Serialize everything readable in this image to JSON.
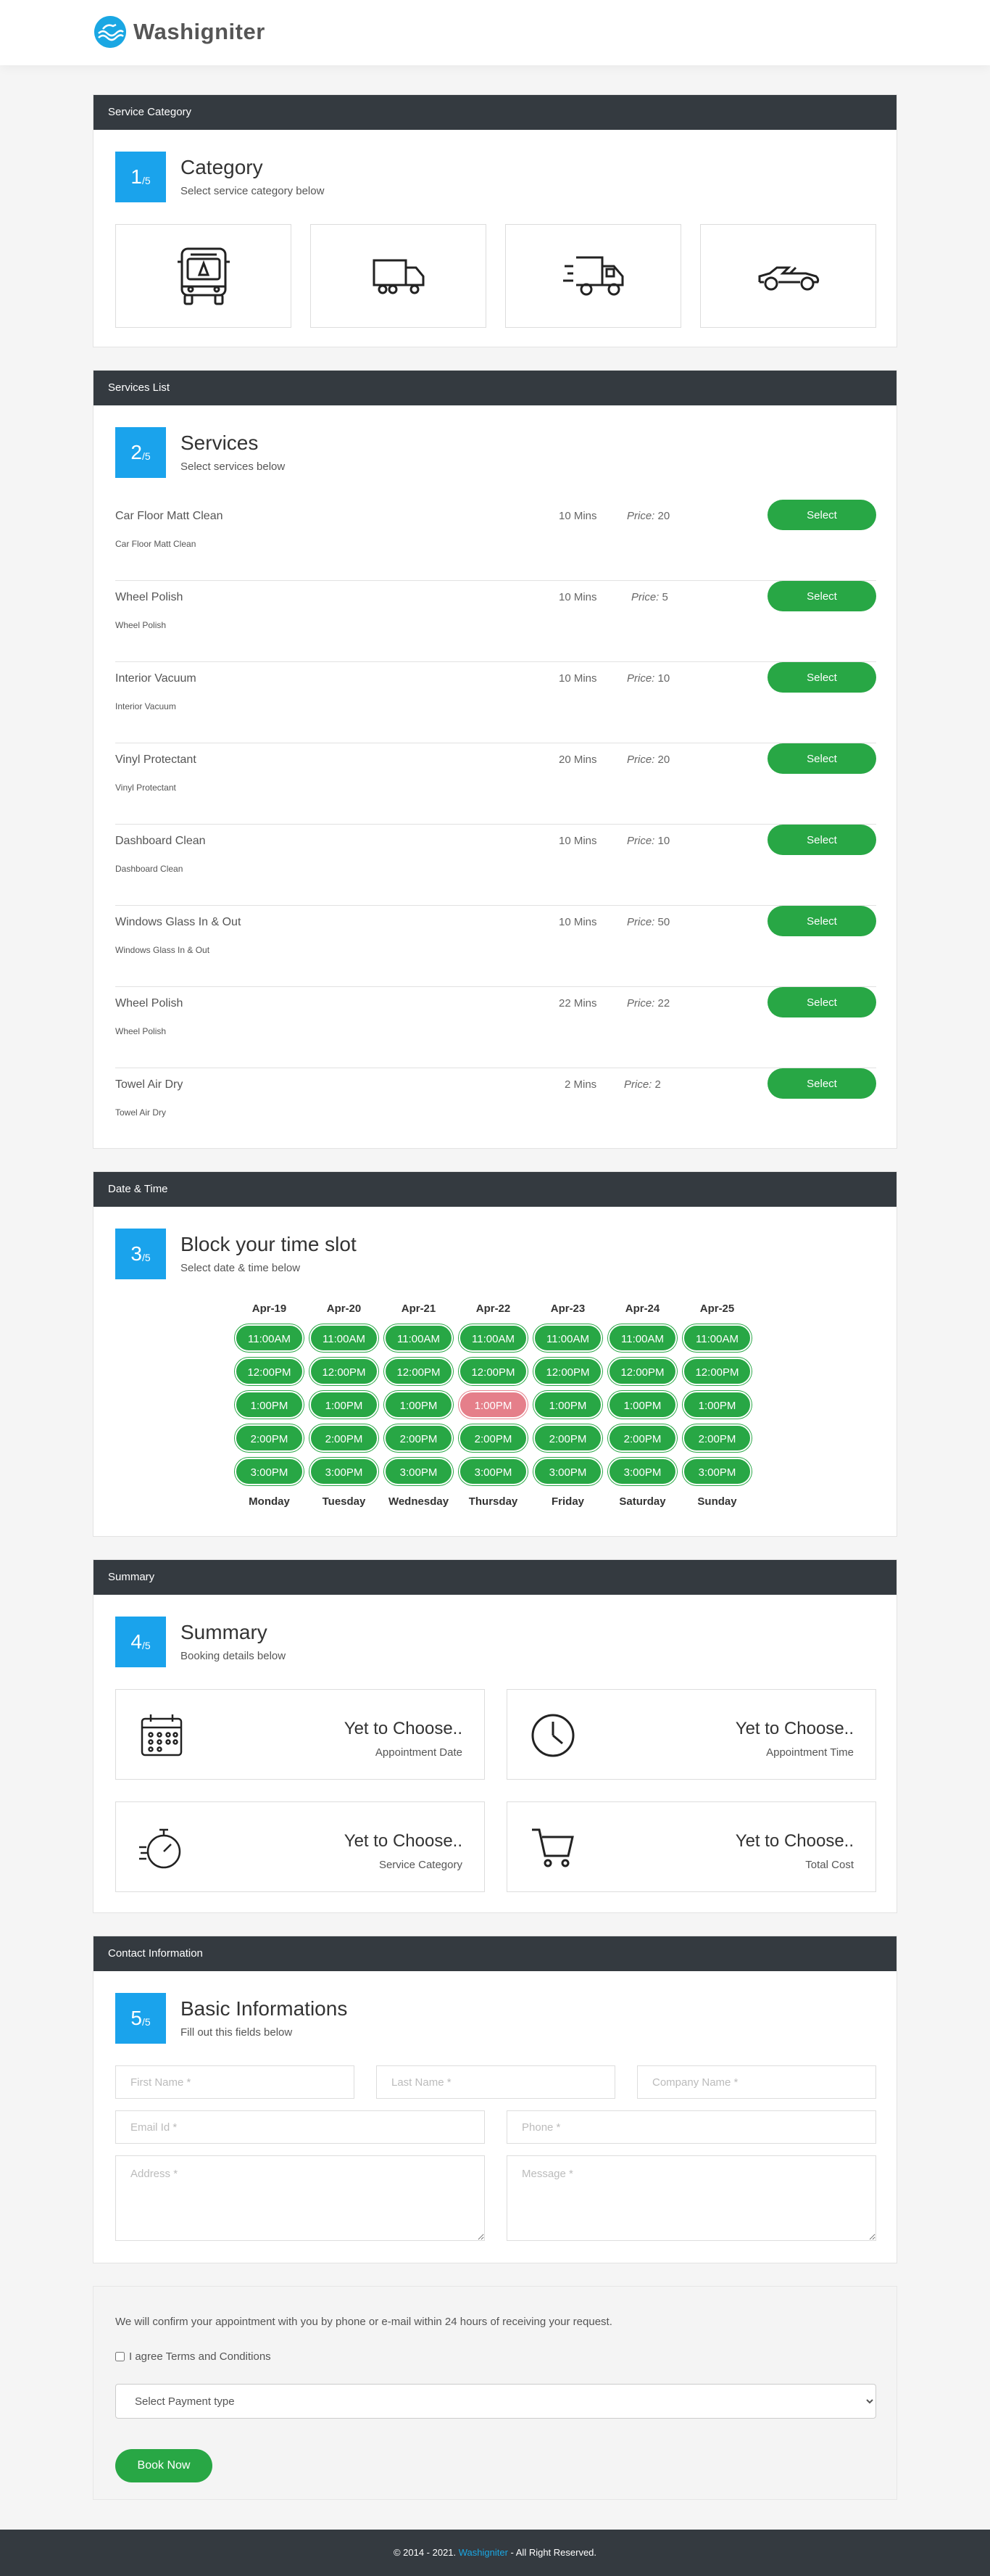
{
  "brand": {
    "name": "Washigniter",
    "logo_icon": "wave-logo-icon",
    "accent": "#1aa7e3"
  },
  "category_section": {
    "header": "Service Category",
    "step_num": "1",
    "step_total": "/5",
    "title": "Category",
    "subtitle": "Select service category below",
    "items": [
      {
        "icon": "bus-icon"
      },
      {
        "icon": "truck-icon"
      },
      {
        "icon": "fast-delivery-truck-icon"
      },
      {
        "icon": "convertible-car-icon"
      }
    ]
  },
  "services_section": {
    "header": "Services List",
    "step_num": "2",
    "step_total": "/5",
    "title": "Services",
    "subtitle": "Select services below",
    "price_label": "Price:",
    "select_label": "Select",
    "items": [
      {
        "name": "Car Floor Matt Clean",
        "desc": "Car Floor Matt Clean",
        "duration": "10 Mins",
        "price": "20"
      },
      {
        "name": "Wheel Polish",
        "desc": "Wheel Polish",
        "duration": "10 Mins",
        "price": "5"
      },
      {
        "name": "Interior Vacuum",
        "desc": "Interior Vacuum",
        "duration": "10 Mins",
        "price": "10"
      },
      {
        "name": "Vinyl Protectant",
        "desc": "Vinyl Protectant",
        "duration": "20 Mins",
        "price": "20"
      },
      {
        "name": "Dashboard Clean",
        "desc": "Dashboard Clean",
        "duration": "10 Mins",
        "price": "10"
      },
      {
        "name": "Windows Glass In & Out",
        "desc": "Windows Glass In & Out",
        "duration": "10 Mins",
        "price": "50"
      },
      {
        "name": "Wheel Polish",
        "desc": "Wheel Polish",
        "duration": "22 Mins",
        "price": "22"
      },
      {
        "name": "Towel Air Dry",
        "desc": "Towel Air Dry",
        "duration": "2 Mins",
        "price": "2"
      }
    ]
  },
  "datetime_section": {
    "header": "Date & Time",
    "step_num": "3",
    "step_total": "/5",
    "title": "Block your time slot",
    "subtitle": "Select date & time below",
    "days": [
      {
        "date": "Apr-19",
        "name": "Monday",
        "slots": [
          "11:00AM",
          "12:00PM",
          "1:00PM",
          "2:00PM",
          "3:00PM"
        ]
      },
      {
        "date": "Apr-20",
        "name": "Tuesday",
        "slots": [
          "11:00AM",
          "12:00PM",
          "1:00PM",
          "2:00PM",
          "3:00PM"
        ]
      },
      {
        "date": "Apr-21",
        "name": "Wednesday",
        "slots": [
          "11:00AM",
          "12:00PM",
          "1:00PM",
          "2:00PM",
          "3:00PM"
        ]
      },
      {
        "date": "Apr-22",
        "name": "Thursday",
        "slots": [
          "11:00AM",
          "12:00PM",
          "1:00PM",
          "2:00PM",
          "3:00PM"
        ]
      },
      {
        "date": "Apr-23",
        "name": "Friday",
        "slots": [
          "11:00AM",
          "12:00PM",
          "1:00PM",
          "2:00PM",
          "3:00PM"
        ]
      },
      {
        "date": "Apr-24",
        "name": "Saturday",
        "slots": [
          "11:00AM",
          "12:00PM",
          "1:00PM",
          "2:00PM",
          "3:00PM"
        ]
      },
      {
        "date": "Apr-25",
        "name": "Sunday",
        "slots": [
          "11:00AM",
          "12:00PM",
          "1:00PM",
          "2:00PM",
          "3:00PM"
        ]
      }
    ],
    "booked_slot": {
      "day": "Apr-22",
      "time": "1:00PM"
    },
    "available_color": "#28a745",
    "booked_color": "#e57f8a"
  },
  "summary_section": {
    "header": "Summary",
    "step_num": "4",
    "step_total": "/5",
    "title": "Summary",
    "subtitle": "Booking details below",
    "items": [
      {
        "icon": "calendar-icon",
        "value": "Yet to Choose..",
        "label": "Appointment Date"
      },
      {
        "icon": "clock-icon",
        "value": "Yet to Choose..",
        "label": "Appointment Time"
      },
      {
        "icon": "stopwatch-icon",
        "value": "Yet to Choose..",
        "label": "Service Category"
      },
      {
        "icon": "cart-icon",
        "value": "Yet to Choose..",
        "label": "Total Cost"
      }
    ]
  },
  "contact_section": {
    "header": "Contact Information",
    "step_num": "5",
    "step_total": "/5",
    "title": "Basic Informations",
    "subtitle": "Fill out this fields below",
    "fields": {
      "first_name": "First Name *",
      "last_name": "Last Name *",
      "company": "Company Name *",
      "email": "Email Id *",
      "phone": "Phone *",
      "address": "Address *",
      "message": "Message *"
    }
  },
  "confirm_section": {
    "text": "We will confirm your appointment with you by phone or e-mail within 24 hours of receiving your request.",
    "terms_label": "I agree Terms and Conditions",
    "payment_selected": "Select Payment type",
    "book_label": "Book Now"
  },
  "footer": {
    "prefix": "© 2014 - 2021. ",
    "brand": "Washigniter",
    "suffix": " - All Right Reserved."
  }
}
